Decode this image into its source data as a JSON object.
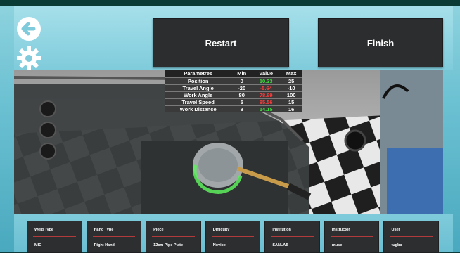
{
  "buttons": {
    "restart": "Restart",
    "finish": "Finish"
  },
  "icons": {
    "back": "back-arrow-icon",
    "settings": "gear-icon"
  },
  "params": {
    "headers": [
      "Parametres",
      "Min",
      "Value",
      "Max"
    ],
    "rows": [
      {
        "name": "Position",
        "min": "0",
        "value": "10.33",
        "max": "25",
        "status": "ok"
      },
      {
        "name": "Travel Angle",
        "min": "-20",
        "value": "-5.64",
        "max": "-10",
        "status": "bad"
      },
      {
        "name": "Work Angle",
        "min": "80",
        "value": "78.69",
        "max": "100",
        "status": "bad"
      },
      {
        "name": "Travel Speed",
        "min": "5",
        "value": "85.56",
        "max": "15",
        "status": "bad"
      },
      {
        "name": "Work Distance",
        "min": "8",
        "value": "14.15",
        "max": "16",
        "status": "ok"
      }
    ]
  },
  "info": [
    {
      "label": "Weld Type",
      "value": "MIG"
    },
    {
      "label": "Hand Type",
      "value": "Right Hand"
    },
    {
      "label": "Piece",
      "value": "12cm Pipe Plate"
    },
    {
      "label": "Difficulty",
      "value": "Novice"
    },
    {
      "label": "Institution",
      "value": "SANLAB"
    },
    {
      "label": "Instructor",
      "value": "muse"
    },
    {
      "label": "User",
      "value": "tugba"
    }
  ],
  "colors": {
    "ok": "#3ddc3d",
    "bad": "#ff3b3b",
    "panel": "#2b2d2e",
    "accent": "#8fd3df"
  }
}
